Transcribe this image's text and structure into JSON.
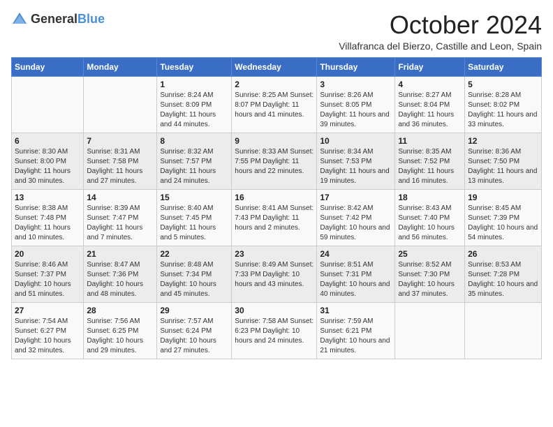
{
  "header": {
    "logo_general": "General",
    "logo_blue": "Blue",
    "title": "October 2024",
    "subtitle": "Villafranca del Bierzo, Castille and Leon, Spain"
  },
  "days_of_week": [
    "Sunday",
    "Monday",
    "Tuesday",
    "Wednesday",
    "Thursday",
    "Friday",
    "Saturday"
  ],
  "weeks": [
    [
      {
        "day": "",
        "info": ""
      },
      {
        "day": "",
        "info": ""
      },
      {
        "day": "1",
        "info": "Sunrise: 8:24 AM\nSunset: 8:09 PM\nDaylight: 11 hours and 44 minutes."
      },
      {
        "day": "2",
        "info": "Sunrise: 8:25 AM\nSunset: 8:07 PM\nDaylight: 11 hours and 41 minutes."
      },
      {
        "day": "3",
        "info": "Sunrise: 8:26 AM\nSunset: 8:05 PM\nDaylight: 11 hours and 39 minutes."
      },
      {
        "day": "4",
        "info": "Sunrise: 8:27 AM\nSunset: 8:04 PM\nDaylight: 11 hours and 36 minutes."
      },
      {
        "day": "5",
        "info": "Sunrise: 8:28 AM\nSunset: 8:02 PM\nDaylight: 11 hours and 33 minutes."
      }
    ],
    [
      {
        "day": "6",
        "info": "Sunrise: 8:30 AM\nSunset: 8:00 PM\nDaylight: 11 hours and 30 minutes."
      },
      {
        "day": "7",
        "info": "Sunrise: 8:31 AM\nSunset: 7:58 PM\nDaylight: 11 hours and 27 minutes."
      },
      {
        "day": "8",
        "info": "Sunrise: 8:32 AM\nSunset: 7:57 PM\nDaylight: 11 hours and 24 minutes."
      },
      {
        "day": "9",
        "info": "Sunrise: 8:33 AM\nSunset: 7:55 PM\nDaylight: 11 hours and 22 minutes."
      },
      {
        "day": "10",
        "info": "Sunrise: 8:34 AM\nSunset: 7:53 PM\nDaylight: 11 hours and 19 minutes."
      },
      {
        "day": "11",
        "info": "Sunrise: 8:35 AM\nSunset: 7:52 PM\nDaylight: 11 hours and 16 minutes."
      },
      {
        "day": "12",
        "info": "Sunrise: 8:36 AM\nSunset: 7:50 PM\nDaylight: 11 hours and 13 minutes."
      }
    ],
    [
      {
        "day": "13",
        "info": "Sunrise: 8:38 AM\nSunset: 7:48 PM\nDaylight: 11 hours and 10 minutes."
      },
      {
        "day": "14",
        "info": "Sunrise: 8:39 AM\nSunset: 7:47 PM\nDaylight: 11 hours and 7 minutes."
      },
      {
        "day": "15",
        "info": "Sunrise: 8:40 AM\nSunset: 7:45 PM\nDaylight: 11 hours and 5 minutes."
      },
      {
        "day": "16",
        "info": "Sunrise: 8:41 AM\nSunset: 7:43 PM\nDaylight: 11 hours and 2 minutes."
      },
      {
        "day": "17",
        "info": "Sunrise: 8:42 AM\nSunset: 7:42 PM\nDaylight: 10 hours and 59 minutes."
      },
      {
        "day": "18",
        "info": "Sunrise: 8:43 AM\nSunset: 7:40 PM\nDaylight: 10 hours and 56 minutes."
      },
      {
        "day": "19",
        "info": "Sunrise: 8:45 AM\nSunset: 7:39 PM\nDaylight: 10 hours and 54 minutes."
      }
    ],
    [
      {
        "day": "20",
        "info": "Sunrise: 8:46 AM\nSunset: 7:37 PM\nDaylight: 10 hours and 51 minutes."
      },
      {
        "day": "21",
        "info": "Sunrise: 8:47 AM\nSunset: 7:36 PM\nDaylight: 10 hours and 48 minutes."
      },
      {
        "day": "22",
        "info": "Sunrise: 8:48 AM\nSunset: 7:34 PM\nDaylight: 10 hours and 45 minutes."
      },
      {
        "day": "23",
        "info": "Sunrise: 8:49 AM\nSunset: 7:33 PM\nDaylight: 10 hours and 43 minutes."
      },
      {
        "day": "24",
        "info": "Sunrise: 8:51 AM\nSunset: 7:31 PM\nDaylight: 10 hours and 40 minutes."
      },
      {
        "day": "25",
        "info": "Sunrise: 8:52 AM\nSunset: 7:30 PM\nDaylight: 10 hours and 37 minutes."
      },
      {
        "day": "26",
        "info": "Sunrise: 8:53 AM\nSunset: 7:28 PM\nDaylight: 10 hours and 35 minutes."
      }
    ],
    [
      {
        "day": "27",
        "info": "Sunrise: 7:54 AM\nSunset: 6:27 PM\nDaylight: 10 hours and 32 minutes."
      },
      {
        "day": "28",
        "info": "Sunrise: 7:56 AM\nSunset: 6:25 PM\nDaylight: 10 hours and 29 minutes."
      },
      {
        "day": "29",
        "info": "Sunrise: 7:57 AM\nSunset: 6:24 PM\nDaylight: 10 hours and 27 minutes."
      },
      {
        "day": "30",
        "info": "Sunrise: 7:58 AM\nSunset: 6:23 PM\nDaylight: 10 hours and 24 minutes."
      },
      {
        "day": "31",
        "info": "Sunrise: 7:59 AM\nSunset: 6:21 PM\nDaylight: 10 hours and 21 minutes."
      },
      {
        "day": "",
        "info": ""
      },
      {
        "day": "",
        "info": ""
      }
    ]
  ]
}
